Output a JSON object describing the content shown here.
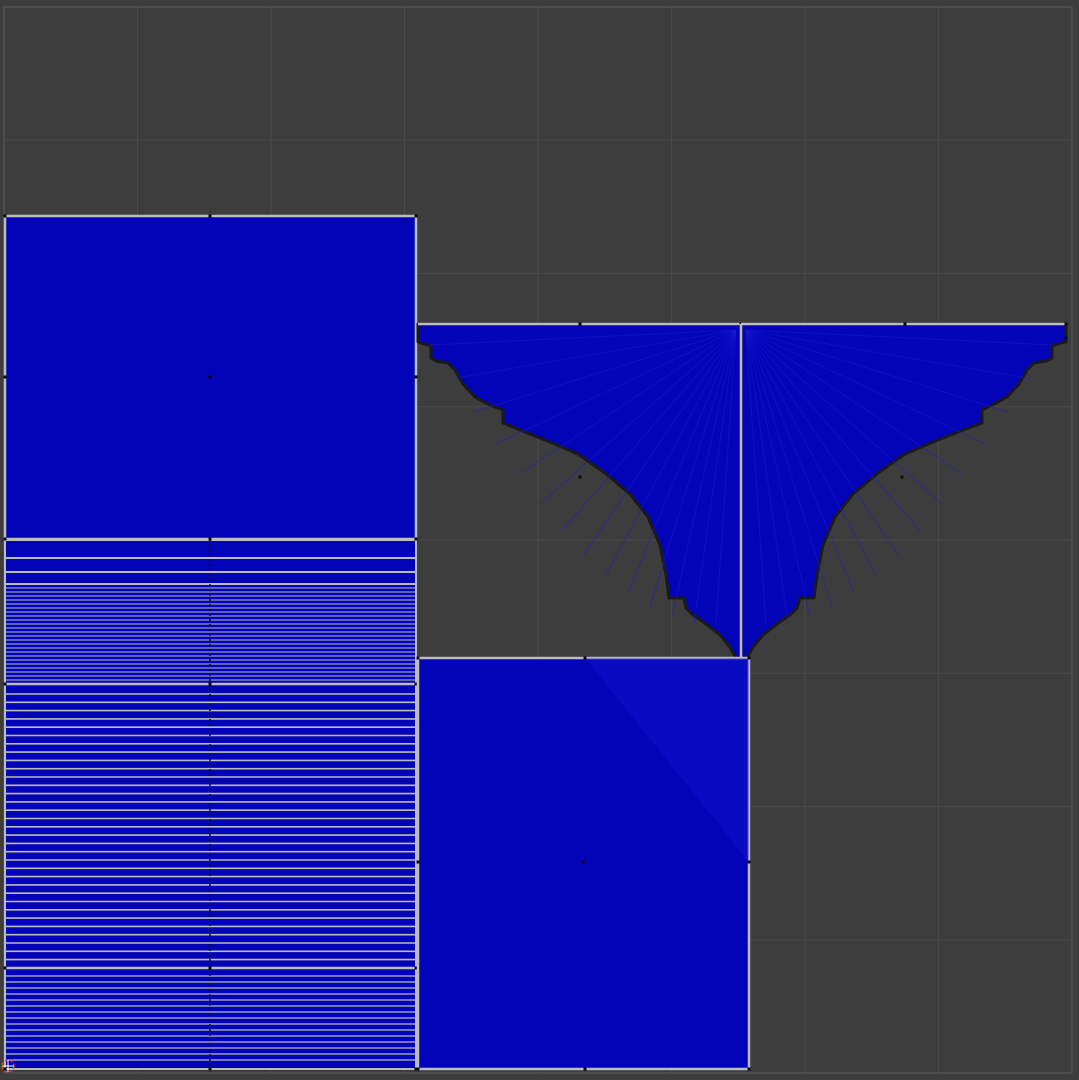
{
  "editor": {
    "background_color": "#3d3d3d",
    "grid_fine_color": "#444444",
    "grid_major_color": "#4a4a4a",
    "uv_bounds_color": "#5a5a5a",
    "face_fill_color": "#0303b8",
    "face_fan_color": "#1a1ad6",
    "edge_color": "#bcbcbc",
    "seam_edge_color": "#1a1a1a",
    "vertex_color": "#0a0a0a",
    "cursor_color": "#d04040"
  },
  "islands": [
    {
      "name": "upper-left-square-face",
      "kind": "single-face"
    },
    {
      "name": "left-strip-faces",
      "kind": "striped",
      "line_count": 96
    },
    {
      "name": "cornice-profile-left",
      "kind": "profile"
    },
    {
      "name": "cornice-profile-right",
      "kind": "profile"
    },
    {
      "name": "lower-middle-square-face",
      "kind": "single-face"
    }
  ],
  "cursor": {
    "name": "2d-cursor",
    "icon": "crosshair-icon"
  }
}
